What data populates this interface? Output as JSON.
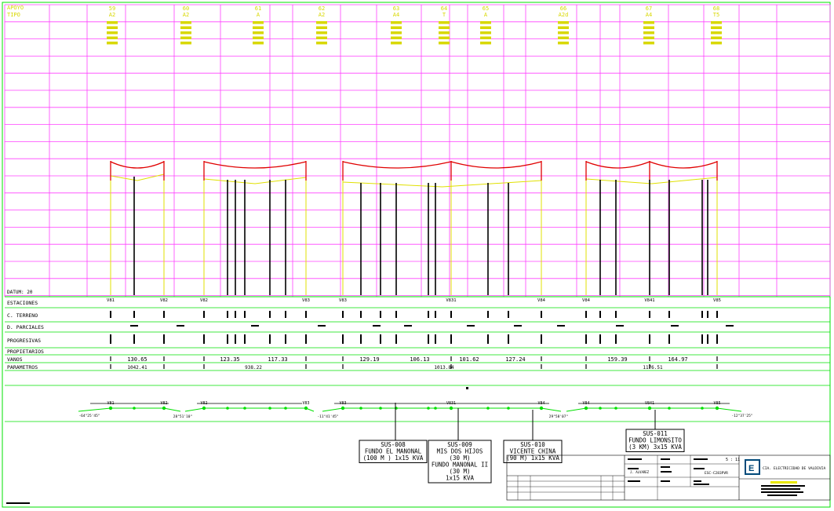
{
  "header": {
    "apoyo_label": "APOYO",
    "tipo_label": "TIPO",
    "columns": [
      {
        "apoyo": "59",
        "tipo": "A2"
      },
      {
        "apoyo": "60",
        "tipo": "A2"
      },
      {
        "apoyo": "61",
        "tipo": "A"
      },
      {
        "apoyo": "62",
        "tipo": "A2"
      },
      {
        "apoyo": "63",
        "tipo": "A4"
      },
      {
        "apoyo": "64",
        "tipo": "T"
      },
      {
        "apoyo": "65",
        "tipo": "A"
      },
      {
        "apoyo": "66",
        "tipo": "A2d"
      },
      {
        "apoyo": "67",
        "tipo": "A4"
      },
      {
        "apoyo": "68",
        "tipo": "T5"
      }
    ]
  },
  "datum_label": "DATUM: 20",
  "table_rows": {
    "estaciones": "ESTACIONES",
    "c_terreno": "C. TERRENO",
    "d_parciales": "D. PARCIALES",
    "progresivas": "PROGRESIVAS",
    "propietarios": "PROPIETARIOS",
    "vanos": "VANOS",
    "parametros": "PARAMETROS"
  },
  "stations": [
    {
      "label": "V81"
    },
    {
      "label": "V82"
    },
    {
      "label": "V82"
    },
    {
      "label": "V83"
    },
    {
      "label": "V83"
    },
    {
      "label": "V831"
    },
    {
      "label": "V84"
    },
    {
      "label": "V84"
    },
    {
      "label": "V841"
    },
    {
      "label": "V85"
    }
  ],
  "vanos": [
    "130.65",
    "123.35",
    "117.33",
    "129.19",
    "106.13",
    "101.62",
    "127.24",
    "159.39",
    "164.97"
  ],
  "parametros": [
    "1042.41",
    "938.22",
    "1013.84",
    "1176.51"
  ],
  "angles": [
    "-64°25'45\"",
    "28°51'10\"",
    "-11°41'45\"",
    "29°58'07\"",
    "-12°37'25\""
  ],
  "substations": [
    {
      "code": "SUS-008",
      "lines": [
        "FUNDO EL MANONAL",
        "(100 M ) 1x15 KVA"
      ]
    },
    {
      "code": "SUS-009",
      "lines": [
        "MIS DOS HIJOS",
        "(30 M)",
        "FUNDO MANONAL II",
        "(30 M)",
        "1x15 KVA"
      ]
    },
    {
      "code": "SUS-010",
      "lines": [
        "VICENTE CHINA",
        "(90 M) 1x15 KVA"
      ]
    },
    {
      "code": "SUS-011",
      "lines": [
        "FUNDO LIMONSITO",
        "(3 KM) 3x15 KVA"
      ]
    }
  ],
  "title_block": {
    "company": "CIA. ELECTRICIDAD DE VALDIVIA",
    "drawn_by": "J. ALVAREZ",
    "plan_code": "ESC-C283PVR",
    "sheet": "5 : 11"
  },
  "colors": {
    "grid": "#ff40ff",
    "border": "#00e000",
    "conductor": "#e00000",
    "ground": "#e0e000",
    "labels": "#d8d800"
  }
}
